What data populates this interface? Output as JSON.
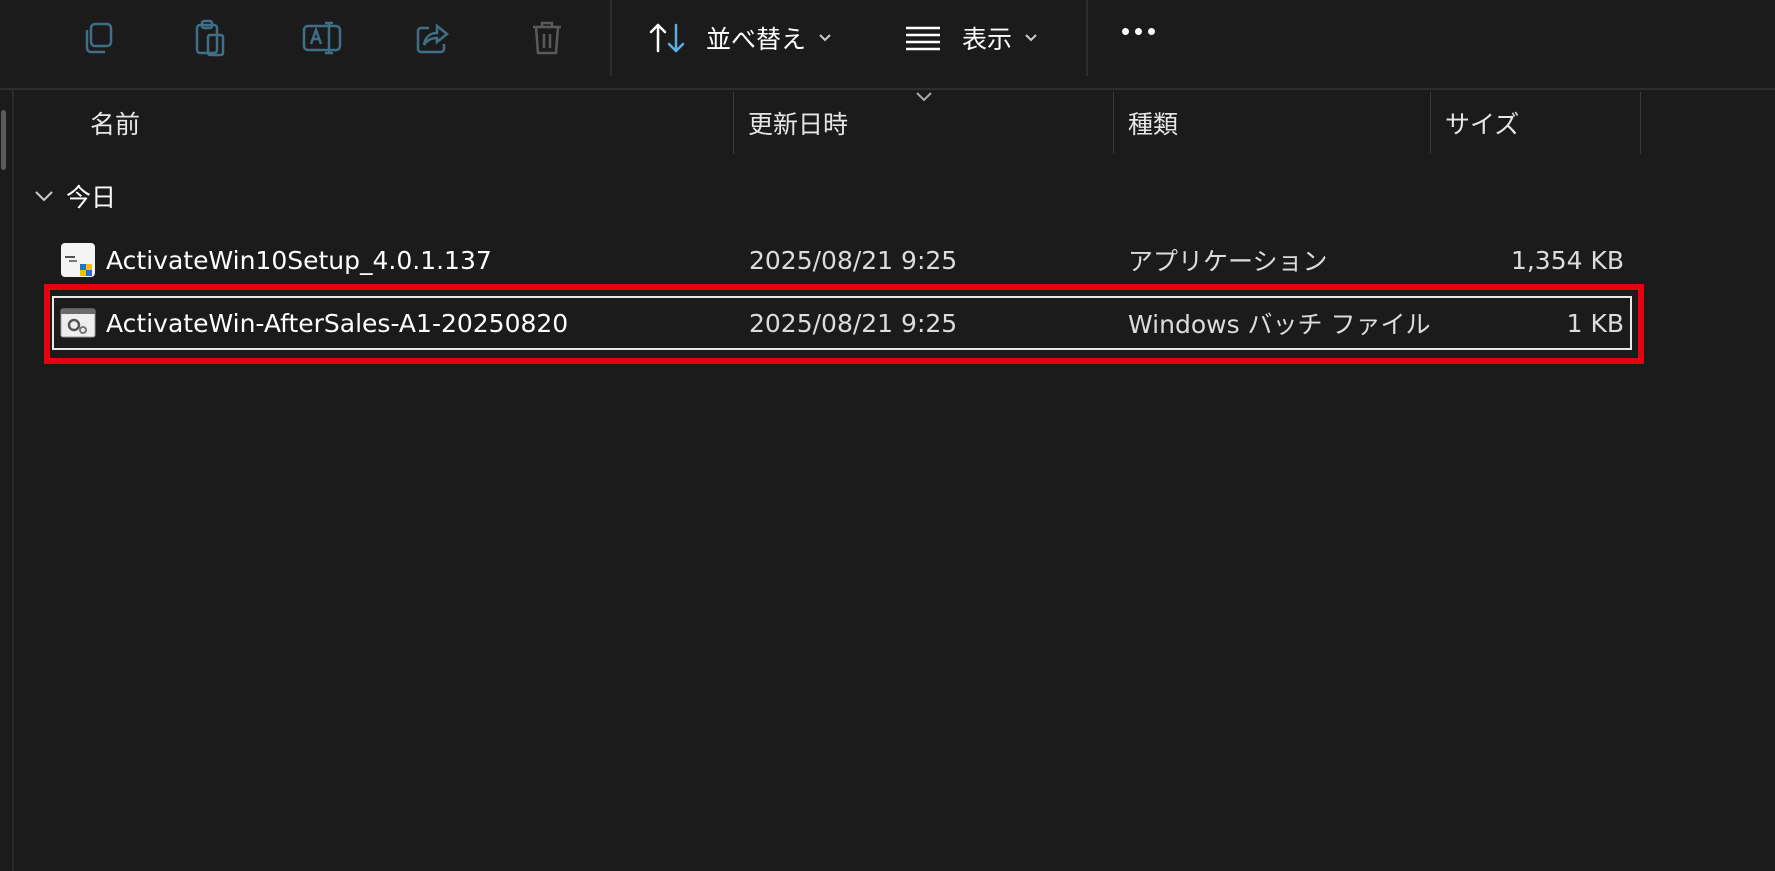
{
  "toolbar": {
    "icons": [
      "copy-icon",
      "paste-icon",
      "rename-icon",
      "share-icon",
      "delete-icon"
    ],
    "sort_label": "並べ替え",
    "view_label": "表示",
    "more_icon": "more-icon"
  },
  "columns": {
    "name": "名前",
    "modified": "更新日時",
    "type": "種類",
    "size": "サイズ"
  },
  "group": {
    "label": "今日"
  },
  "files": [
    {
      "name": "ActivateWin10Setup_4.0.1.137",
      "modified": "2025/08/21 9:25",
      "type": "アプリケーション",
      "size": "1,354 KB",
      "icon": "application-icon"
    },
    {
      "name": "ActivateWin-AfterSales-A1-20250820",
      "modified": "2025/08/21 9:25",
      "type": "Windows バッチ ファイル",
      "size": "1 KB",
      "icon": "batch-file-icon"
    }
  ],
  "colors": {
    "background": "#1b1b1b",
    "highlight": "#e4000f",
    "selection_border": "#e8e8e8"
  }
}
